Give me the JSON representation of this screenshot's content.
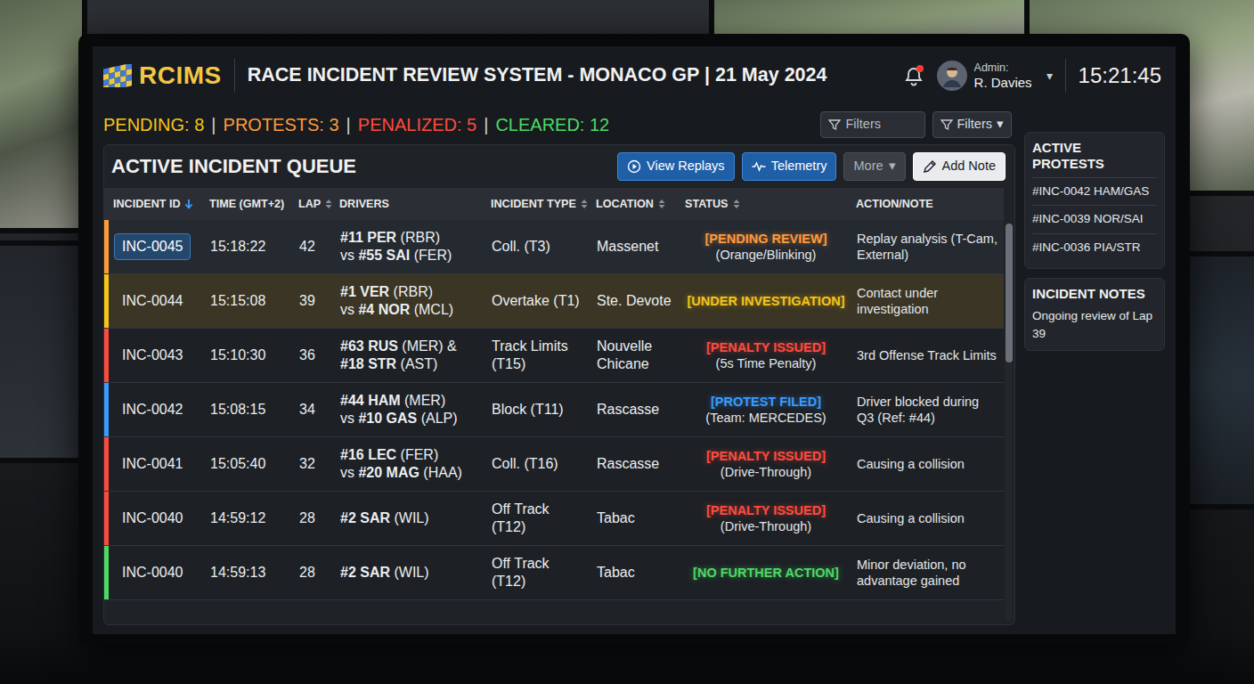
{
  "app": {
    "logo": "RCIMS",
    "title": "RACE INCIDENT REVIEW SYSTEM - MONACO GP | 21 May 2024",
    "notifications_unread": true,
    "user_role": "Admin:",
    "user_name": "R. Davies",
    "user_menu": "▾",
    "clock": "15:21:45"
  },
  "stats": [
    {
      "label": "PENDING: 8",
      "color": "#f5c518"
    },
    {
      "label": "PROTESTS: 3",
      "color": "#ff9a3c"
    },
    {
      "label": "PENALIZED: 5",
      "color": "#ff4b3e"
    },
    {
      "label": "CLEARED: 12",
      "color": "#4cd964"
    }
  ],
  "stats_separator": "|",
  "filters": {
    "search": {
      "placeholder": "Filters"
    },
    "dropdown": {
      "label": "Filters",
      "caret": "▾"
    }
  },
  "queue": {
    "title": "ACTIVE INCIDENT QUEUE",
    "buttons": [
      {
        "label": "View Replays",
        "kind": "replay"
      },
      {
        "label": "Telemetry",
        "kind": "telemetry"
      },
      {
        "label": "More",
        "kind": "more",
        "caret": "▾"
      },
      {
        "label": "Add Note",
        "kind": "note"
      }
    ],
    "columns": [
      {
        "label": "INCIDENT ID",
        "sort": "desc"
      },
      {
        "label": "TIME (GMT+2)",
        "sort": "none"
      },
      {
        "label": "LAP",
        "sort": "both"
      },
      {
        "label": "DRIVERS",
        "sort": "none"
      },
      {
        "label": "INCIDENT TYPE",
        "sort": "both"
      },
      {
        "label": "LOCATION",
        "sort": "both"
      },
      {
        "label": "STATUS",
        "sort": "both"
      },
      {
        "label": "ACTION/NOTE",
        "sort": "none"
      }
    ],
    "rows": [
      {
        "id": "INC-0045",
        "time": "15:18:22",
        "lap": "42",
        "drivers": [
          [
            {
              "text": "#11 PER",
              "bold": true
            },
            {
              "text": " (RBR)",
              "bold": false
            }
          ],
          [
            {
              "text": "vs ",
              "bold": false
            },
            {
              "text": "#55 SAI",
              "bold": true
            },
            {
              "text": " (FER)",
              "bold": false
            }
          ]
        ],
        "type": "Coll. (T3)",
        "location": "Massenet",
        "status": "[PENDING REVIEW]",
        "status_detail": "(Orange/Blinking)",
        "color": "#ff9a3c",
        "note": "Replay analysis (T-Cam, External)",
        "selected": true,
        "highlighted": false
      },
      {
        "id": "INC-0044",
        "time": "15:15:08",
        "lap": "39",
        "drivers": [
          [
            {
              "text": "#1 VER",
              "bold": true
            },
            {
              "text": " (RBR)",
              "bold": false
            }
          ],
          [
            {
              "text": "vs ",
              "bold": false
            },
            {
              "text": "#4 NOR",
              "bold": true
            },
            {
              "text": " (MCL)",
              "bold": false
            }
          ]
        ],
        "type": "Overtake (T1)",
        "location": "Ste. Devote",
        "status": "[UNDER INVESTIGATION]",
        "color": "#f5c518",
        "note": "Contact under investigation",
        "selected": false,
        "highlighted": true
      },
      {
        "id": "INC-0043",
        "time": "15:10:30",
        "lap": "36",
        "drivers": [
          [
            {
              "text": "#63 RUS",
              "bold": true
            },
            {
              "text": " (MER) &",
              "bold": false
            }
          ],
          [
            {
              "text": "#18 STR",
              "bold": true
            },
            {
              "text": " (AST)",
              "bold": false
            }
          ]
        ],
        "type": "Track Limits (T15)",
        "location": "Nouvelle Chicane",
        "status": "[PENALTY ISSUED]",
        "status_detail": "(5s Time Penalty)",
        "color": "#ff4b3e",
        "note": "3rd Offense Track Limits",
        "selected": false,
        "highlighted": false
      },
      {
        "id": "INC-0042",
        "time": "15:08:15",
        "lap": "34",
        "drivers": [
          [
            {
              "text": "#44 HAM",
              "bold": true
            },
            {
              "text": " (MER)",
              "bold": false
            }
          ],
          [
            {
              "text": "vs ",
              "bold": false
            },
            {
              "text": "#10 GAS",
              "bold": true
            },
            {
              "text": " (ALP)",
              "bold": false
            }
          ]
        ],
        "type": "Block (T11)",
        "location": "Rascasse",
        "status": "[PROTEST FILED]",
        "status_detail": "(Team: MERCEDES)",
        "color": "#3b9cff",
        "note": "Driver blocked during Q3 (Ref: #44)",
        "selected": false,
        "highlighted": false
      },
      {
        "id": "INC-0041",
        "time": "15:05:40",
        "lap": "32",
        "drivers": [
          [
            {
              "text": "#16 LEC",
              "bold": true
            },
            {
              "text": " (FER)",
              "bold": false
            }
          ],
          [
            {
              "text": "vs ",
              "bold": false
            },
            {
              "text": "#20 MAG",
              "bold": true
            },
            {
              "text": " (HAA)",
              "bold": false
            }
          ]
        ],
        "type": "Coll. (T16)",
        "location": "Rascasse",
        "status": "[PENALTY ISSUED]",
        "status_detail": "(Drive-Through)",
        "color": "#ff4b3e",
        "note": "Causing a collision",
        "selected": false,
        "highlighted": false
      },
      {
        "id": "INC-0040",
        "time": "14:59:12",
        "lap": "28",
        "drivers": [
          [
            {
              "text": "#2 SAR",
              "bold": true
            },
            {
              "text": " (WIL)",
              "bold": false
            }
          ]
        ],
        "type": "Off Track (T12)",
        "location": "Tabac",
        "status": "[PENALTY ISSUED]",
        "status_detail": "(Drive-Through)",
        "color": "#ff4b3e",
        "note": "Causing a collision",
        "selected": false,
        "highlighted": false
      },
      {
        "id": "INC-0040",
        "time": "14:59:13",
        "lap": "28",
        "drivers": [
          [
            {
              "text": "#2 SAR",
              "bold": true
            },
            {
              "text": " (WIL)",
              "bold": false
            }
          ]
        ],
        "type": "Off Track (T12)",
        "location": "Tabac",
        "status": "[NO FURTHER ACTION]",
        "color": "#4cd964",
        "note": "Minor deviation, no advantage gained",
        "selected": false,
        "highlighted": false
      }
    ],
    "scrollbar": {
      "level": 0.35
    }
  },
  "protests": {
    "title": "ACTIVE PROTESTS",
    "items": [
      "#INC-0042 HAM/GAS",
      "#INC-0039 NOR/SAI",
      "#INC-0036 PIA/STR"
    ]
  },
  "notes": {
    "title": "INCIDENT NOTES",
    "text": "Ongoing review of Lap 39"
  }
}
